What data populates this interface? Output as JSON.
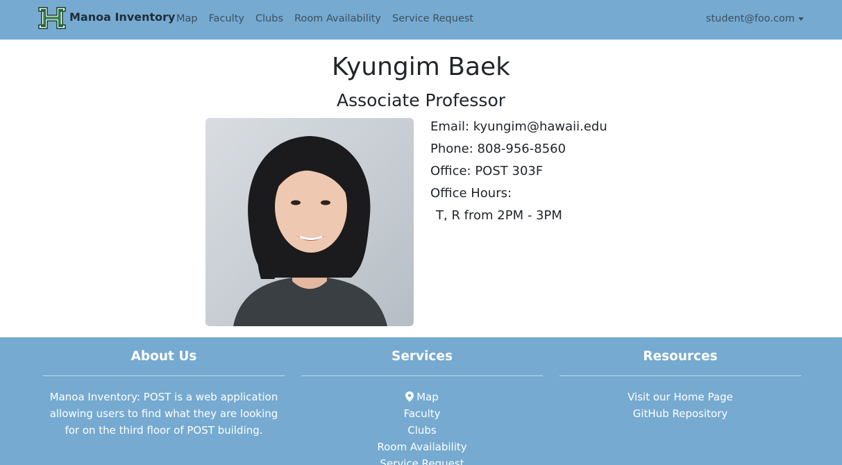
{
  "navbar": {
    "brand": "Manoa Inventory",
    "links": [
      "Map",
      "Faculty",
      "Clubs",
      "Room Availability",
      "Service Request"
    ],
    "user": "student@foo.com"
  },
  "profile": {
    "name": "Kyungim Baek",
    "title": "Associate Professor",
    "email": "Email: kyungim@hawaii.edu",
    "phone": "Phone: 808-956-8560",
    "office": "Office: POST 303F",
    "office_hours_label": "Office Hours:",
    "office_hours": "T, R from 2PM - 3PM"
  },
  "footer": {
    "about": {
      "heading": "About Us",
      "text": "Manoa Inventory: POST is a web application allowing users to find what they are looking for on the third floor of POST building."
    },
    "services": {
      "heading": "Services",
      "links": [
        "Map",
        "Faculty",
        "Clubs",
        "Room Availability",
        "Service Request"
      ]
    },
    "resources": {
      "heading": "Resources",
      "links": [
        "Visit our Home Page",
        "GitHub Repository"
      ]
    }
  },
  "colors": {
    "navbar_bg": "#76aad0",
    "footer_bg": "#76aad0",
    "logo_green": "#1e6b3c"
  },
  "icons": {
    "logo": "uh-h-logo",
    "map": "map-marker-icon",
    "user_menu": "caret-down-icon"
  }
}
